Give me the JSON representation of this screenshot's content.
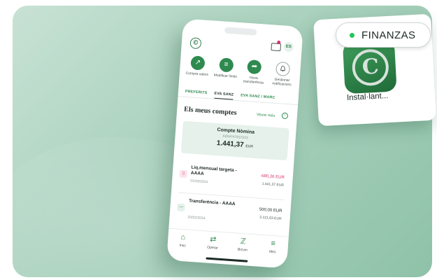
{
  "phone": {
    "logo": "©",
    "avatar": "ES",
    "actions": [
      {
        "icon": "trend-up-icon",
        "glyph": "↗",
        "label": "Compra valors",
        "style": "filled"
      },
      {
        "icon": "sliders-icon",
        "glyph": "≡",
        "label": "Modificar límits",
        "style": "filled"
      },
      {
        "icon": "share-arrow-icon",
        "glyph": "➦",
        "label": "Nova transferència",
        "style": "filled"
      },
      {
        "icon": "bell-icon",
        "glyph": "🔔",
        "label": "Gestionar notificacions",
        "style": "outline"
      }
    ],
    "tabs": [
      "PREFERITS",
      "EVA SANZ",
      "EVA SANZ / MARC"
    ],
    "section_title": "Els meus comptes",
    "see_more": "Veure més",
    "account": {
      "name": "Compte Nòmina",
      "iban": "AD54*47610102",
      "balance": "1.441,37",
      "currency": "EUR"
    },
    "transactions": [
      {
        "icon": "card-icon",
        "glyph": "▯",
        "title": "Liq.mensual targeta - AAAA",
        "date": "01/03/2024",
        "amount": "-680,26 EUR",
        "balance": "1.441,37 EUR"
      },
      {
        "icon": "transfer-icon",
        "glyph": "—",
        "title": "Transferència - AAAA",
        "date": "29/02/2024",
        "amount": "500,00 EUR",
        "balance": "2.121,63 EUR"
      }
    ],
    "nav": [
      {
        "icon": "home-icon",
        "glyph": "⌂",
        "label": "Inici"
      },
      {
        "icon": "swap-icon",
        "glyph": "⇄",
        "label": "Operar"
      },
      {
        "icon": "bizum-icon",
        "glyph": "ℤ",
        "label": "Bizum"
      },
      {
        "icon": "menu-icon",
        "glyph": "≡",
        "label": "Més"
      }
    ]
  },
  "app_card": {
    "glyph": "C",
    "label": "Instal·lant..."
  },
  "badge": {
    "label": "FINANZAS",
    "dot_color": "#22c55e"
  },
  "colors": {
    "brand_green": "#2e8a4f",
    "negative": "#d8326c"
  }
}
